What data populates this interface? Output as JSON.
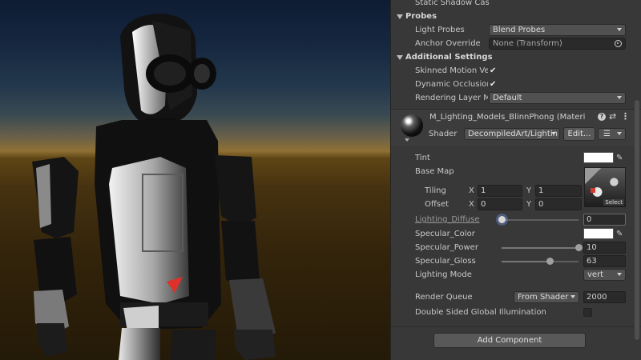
{
  "inspector": {
    "static_shadow_label": "Static Shadow Cas",
    "probes": {
      "header": "Probes",
      "light_probes_label": "Light Probes",
      "light_probes_value": "Blend Probes",
      "anchor_override_label": "Anchor Override",
      "anchor_override_value": "None (Transform)"
    },
    "additional": {
      "header": "Additional Settings",
      "skinned_motion_label": "Skinned Motion Ve",
      "dynamic_occlusion_label": "Dynamic Occlusion",
      "rendering_layer_label": "Rendering Layer M",
      "rendering_layer_value": "Default",
      "check_glyph": "✔"
    },
    "material": {
      "name": "M_Lighting_Models_BlinnPhong (Materi",
      "shader_label": "Shader",
      "shader_value": "DecompiledArt/Lightin",
      "edit_label": "Edit...",
      "list_glyph": "☰"
    },
    "properties": {
      "tint_label": "Tint",
      "base_map_label": "Base Map",
      "tiling_label": "Tiling",
      "tiling_x": "1",
      "tiling_y": "1",
      "offset_label": "Offset",
      "offset_x": "0",
      "offset_y": "0",
      "x_axis": "X",
      "y_axis": "Y",
      "select_label": "Select",
      "lighting_diffuse_label": "Lighting_Diffuse",
      "lighting_diffuse_value": "0",
      "specular_color_label": "Specular_Color",
      "specular_power_label": "Specular_Power",
      "specular_power_value": "10",
      "specular_power_fraction": 1.0,
      "specular_gloss_label": "Specular_Gloss",
      "specular_gloss_value": "63",
      "specular_gloss_fraction": 0.62,
      "lighting_diffuse_fraction": 0.0,
      "lighting_mode_label": "Lighting Mode",
      "lighting_mode_value": "vert",
      "render_queue_label": "Render Queue",
      "render_queue_mode": "From Shader",
      "render_queue_value": "2000",
      "double_sided_label": "Double Sided Global Illumination"
    },
    "add_component_label": "Add Component"
  },
  "colors": {
    "inspector_bg": "#383838",
    "field_bg": "#2a2a2a",
    "swatch_white": "#ffffff",
    "marker_red": "#e0302a"
  },
  "icons": [
    "checkmark-icon",
    "dropdown-arrow-icon",
    "object-picker-icon",
    "eyedropper-icon",
    "help-icon",
    "preset-icon",
    "kebab-menu-icon",
    "material-sphere-icon",
    "texture-thumbnail-icon",
    "list-menu-icon"
  ]
}
